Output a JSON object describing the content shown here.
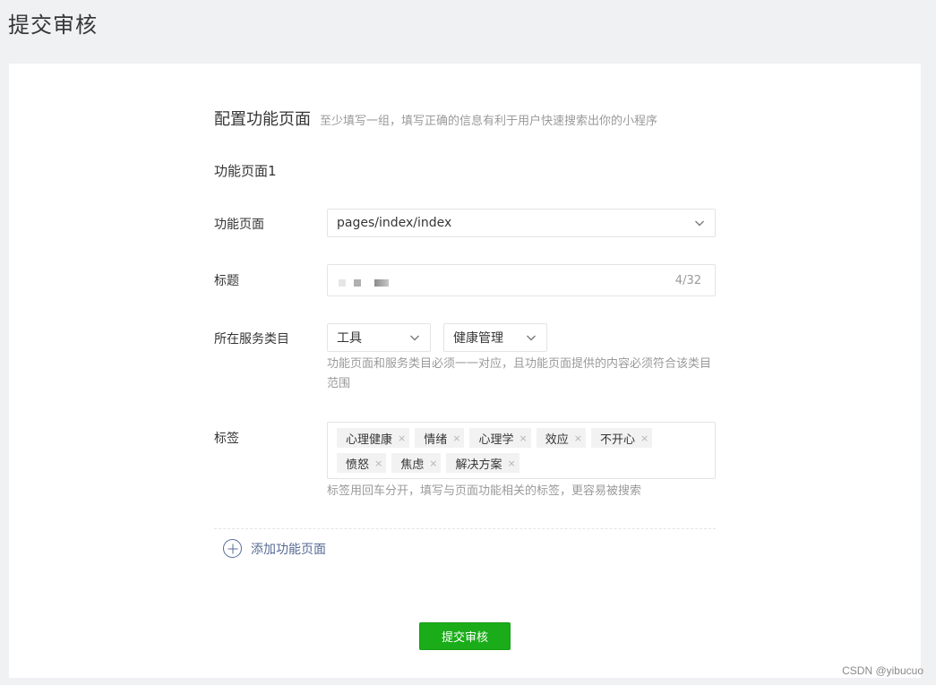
{
  "page": {
    "title": "提交审核"
  },
  "section": {
    "title": "配置功能页面",
    "subtitle": "至少填写一组，填写正确的信息有利于用户快速搜索出你的小程序"
  },
  "group": {
    "title": "功能页面1"
  },
  "fields": {
    "page": {
      "label": "功能页面",
      "value": "pages/index/index"
    },
    "title": {
      "label": "标题",
      "counter": "4/32"
    },
    "category": {
      "label": "所在服务类目",
      "level1": "工具",
      "level2": "健康管理",
      "hint": "功能页面和服务类目必须一一对应，且功能页面提供的内容必须符合该类目范围"
    },
    "tags": {
      "label": "标签",
      "items": [
        "心理健康",
        "情绪",
        "心理学",
        "效应",
        "不开心",
        "愤怒",
        "焦虑",
        "解决方案"
      ],
      "remove_glyph": "×",
      "hint": "标签用回车分开，填写与页面功能相关的标签，更容易被搜索"
    }
  },
  "add_page": {
    "label": "添加功能页面"
  },
  "submit": {
    "label": "提交审核"
  },
  "watermark": "CSDN @yibucuo",
  "colors": {
    "primary": "#1aad19",
    "link": "#576b95",
    "background": "#f0f1f3"
  },
  "icons": [
    "chevron-down-icon",
    "plus-circle-icon",
    "tag-remove-icon"
  ]
}
